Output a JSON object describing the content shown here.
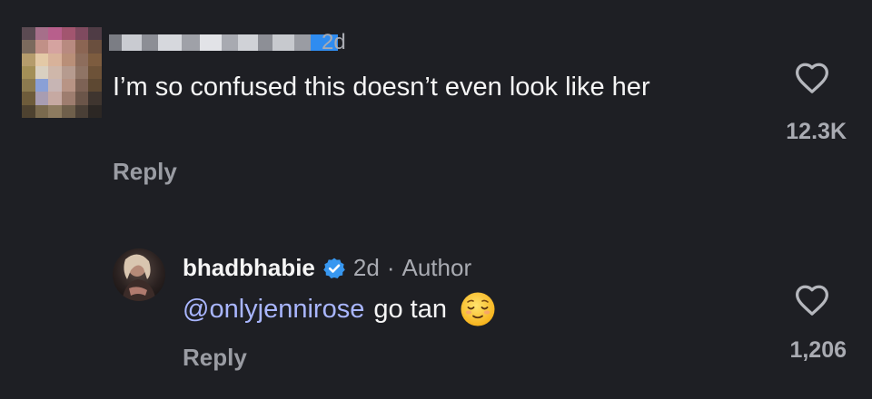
{
  "comment1": {
    "time": "2d",
    "text": "I’m so confused this doesn’t even look like her",
    "reply_label": "Reply",
    "likes": "12.3K"
  },
  "comment2": {
    "username": "bhadbhabie",
    "time": "2d",
    "separator": "·",
    "role": "Author",
    "mention": "@onlyjennirose",
    "text": "go tan",
    "reply_label": "Reply",
    "likes": "1,206"
  },
  "colors": {
    "background": "#1e1f24",
    "text_primary": "#f5f5f5",
    "text_secondary": "#a9abb2",
    "mention": "#a9b6ff",
    "verified": "#3797f0"
  },
  "icons": [
    "heart-outline-icon",
    "verified-badge-icon",
    "relieved-face-emoji"
  ]
}
